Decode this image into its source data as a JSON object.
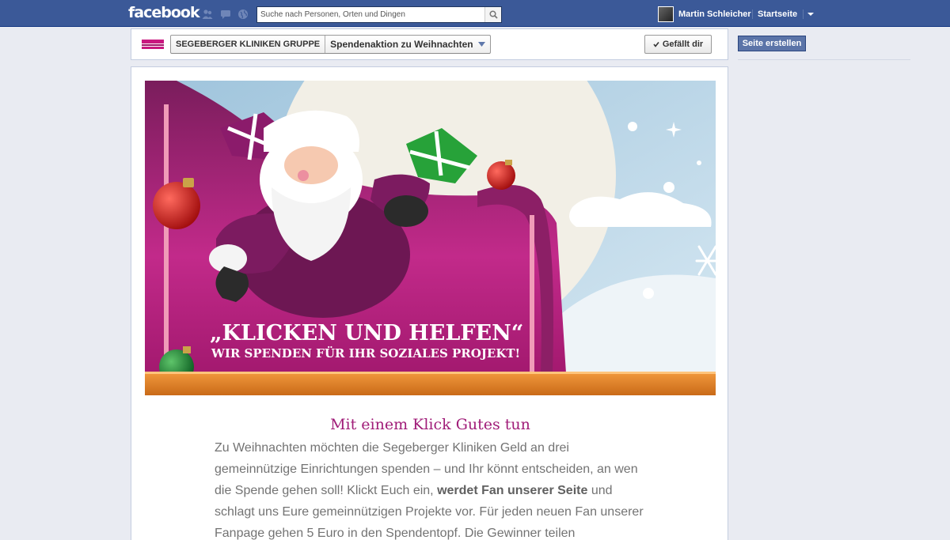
{
  "topbar": {
    "logo": "facebook",
    "search_placeholder": "Suche nach Personen, Orten und Dingen",
    "user_name": "Martin Schleicher",
    "home_label": "Startseite",
    "icons": [
      "friends-icon",
      "messages-icon",
      "globe-icon",
      "search-icon",
      "chevron-down-icon"
    ]
  },
  "page_header": {
    "page_name": "SEGEBERGER KLINIKEN GRUPPE",
    "tab_name": "Spendenaktion zu Weihnachten",
    "like_label": "Gefällt dir"
  },
  "sidebar": {
    "create_page_label": "Seite erstellen"
  },
  "banner": {
    "headline": "„KLICKEN UND HELFEN“",
    "subline": "WIR SPENDEN FÜR IHR SOZIALES PROJEKT!"
  },
  "content": {
    "title": "Mit einem Klick Gutes tun",
    "body_before": "Zu Weihnachten möchten die Segeberger Kliniken Geld an drei gemeinnützige Einrichtungen spenden – und Ihr könnt entscheiden, an wen die Spende gehen soll! Klickt Euch ein, ",
    "body_bold": "werdet Fan unserer Seite",
    "body_after": " und schlagt uns Eure gemeinnützigen Projekte vor. Für jeden neuen Fan unserer Fanpage gehen 5 Euro in den Spendentopf. Die Gewinner teilen"
  },
  "colors": {
    "fb_blue": "#3b5998",
    "accent_magenta": "#a01c78",
    "body_text": "#737373"
  }
}
